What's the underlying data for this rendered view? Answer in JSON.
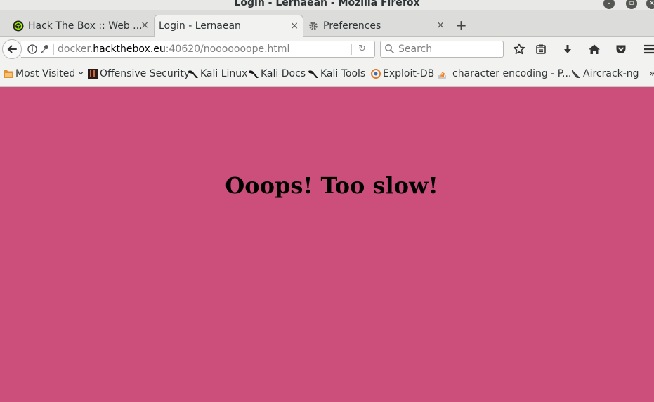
{
  "window": {
    "title": "Login - Lernaean - Mozilla Firefox"
  },
  "tabs": [
    {
      "label": "Hack The Box :: Web ...",
      "close": "×"
    },
    {
      "label": "Login - Lernaean",
      "close": "×"
    },
    {
      "label": "Preferences",
      "close": "×"
    }
  ],
  "new_tab": "+",
  "navbar": {
    "url_prefix": "docker.",
    "url_host": "hackthebox.eu",
    "url_suffix": ":40620/nooooooope.html",
    "reload": "↻",
    "search_placeholder": "Search"
  },
  "bookmarks": [
    {
      "label": "Most Visited",
      "chevron": "⌄"
    },
    {
      "label": "Offensive Security"
    },
    {
      "label": "Kali Linux"
    },
    {
      "label": "Kali Docs"
    },
    {
      "label": "Kali Tools"
    },
    {
      "label": "Exploit-DB"
    },
    {
      "label": "character encoding - P..."
    },
    {
      "label": "Aircrack-ng"
    }
  ],
  "bookmarks_overflow": "»",
  "page": {
    "heading": "Ooops! Too slow!",
    "background": "#cc4e7a"
  },
  "colors": {
    "page_bg": "#cc4e7a",
    "chrome_bg": "#f2f2f1"
  },
  "icons": [
    "minimize-icon",
    "maximize-icon",
    "close-icon",
    "htb-cube-icon",
    "gear-icon",
    "back-arrow-icon",
    "info-icon",
    "key-icon",
    "reload-icon",
    "search-icon",
    "star-icon",
    "reading-list-icon",
    "download-icon",
    "home-icon",
    "pocket-icon",
    "menu-icon"
  ]
}
